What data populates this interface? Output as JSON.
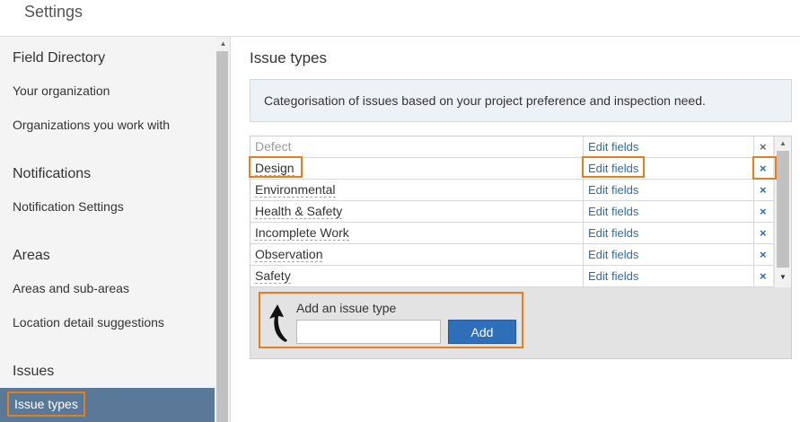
{
  "header": {
    "title": "Settings"
  },
  "sidebar": {
    "sections": [
      {
        "heading": "Field Directory",
        "items": [
          "Your organization",
          "Organizations you work with"
        ]
      },
      {
        "heading": "Notifications",
        "items": [
          "Notification Settings"
        ]
      },
      {
        "heading": "Areas",
        "items": [
          "Areas and sub-areas",
          "Location detail suggestions"
        ]
      },
      {
        "heading": "Issues",
        "items": [
          "Issue types"
        ]
      }
    ],
    "active_item": "Issue types",
    "active_color": "#5a7999"
  },
  "main": {
    "title": "Issue types",
    "info": "Categorisation of issues based on your project preference and inspection need.",
    "edit_label": "Edit fields",
    "delete_symbol": "×",
    "rows": [
      {
        "name": "Defect",
        "disabled": true
      },
      {
        "name": "Design",
        "disabled": false
      },
      {
        "name": "Environmental",
        "disabled": false
      },
      {
        "name": "Health & Safety",
        "disabled": false
      },
      {
        "name": "Incomplete Work",
        "disabled": false
      },
      {
        "name": "Observation",
        "disabled": false
      },
      {
        "name": "Safety",
        "disabled": false
      }
    ],
    "add": {
      "label": "Add an issue type",
      "input_value": "",
      "button": "Add"
    }
  },
  "colors": {
    "highlight": "#e57f1d",
    "link": "#2e6da4",
    "button": "#2f6fba"
  },
  "icons": {
    "scroll_up": "triangle-up-icon",
    "scroll_down": "triangle-down-icon",
    "delete": "close-icon",
    "arrow": "curved-arrow-up-icon"
  }
}
